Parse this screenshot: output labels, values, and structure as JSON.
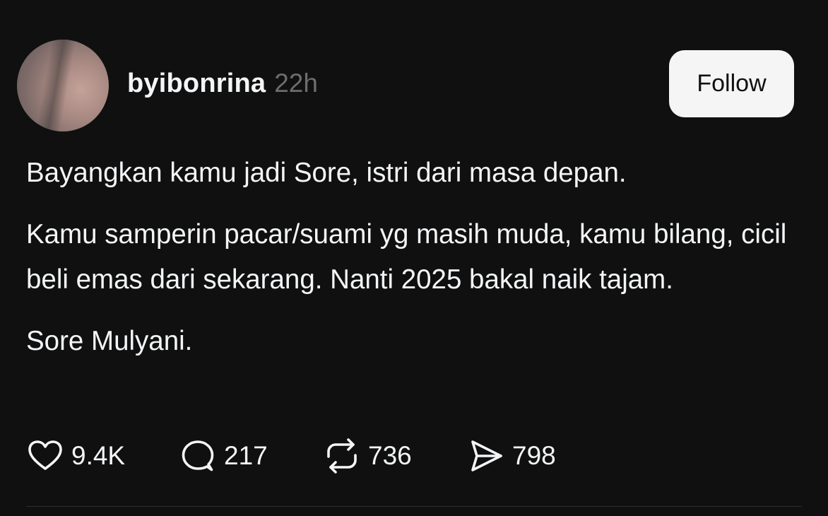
{
  "post": {
    "author": {
      "username": "byibonrina",
      "timestamp": "22h"
    },
    "follow_label": "Follow",
    "paragraphs": [
      "Bayangkan kamu jadi Sore, istri dari masa depan.",
      "Kamu samperin pacar/suami yg masih muda, kamu bilang, cicil beli emas dari sekarang. Nanti 2025 bakal naik tajam.",
      "Sore Mulyani."
    ],
    "actions": {
      "likes": {
        "icon": "heart-icon",
        "count": "9.4K"
      },
      "replies": {
        "icon": "speech-bubble-icon",
        "count": "217"
      },
      "reposts": {
        "icon": "repost-icon",
        "count": "736"
      },
      "shares": {
        "icon": "send-icon",
        "count": "798"
      }
    }
  },
  "colors": {
    "background": "#101010",
    "text": "#f3f5f7",
    "muted": "#6d6d6d",
    "button_bg": "#f5f5f5",
    "divider": "#2e2e2e"
  }
}
